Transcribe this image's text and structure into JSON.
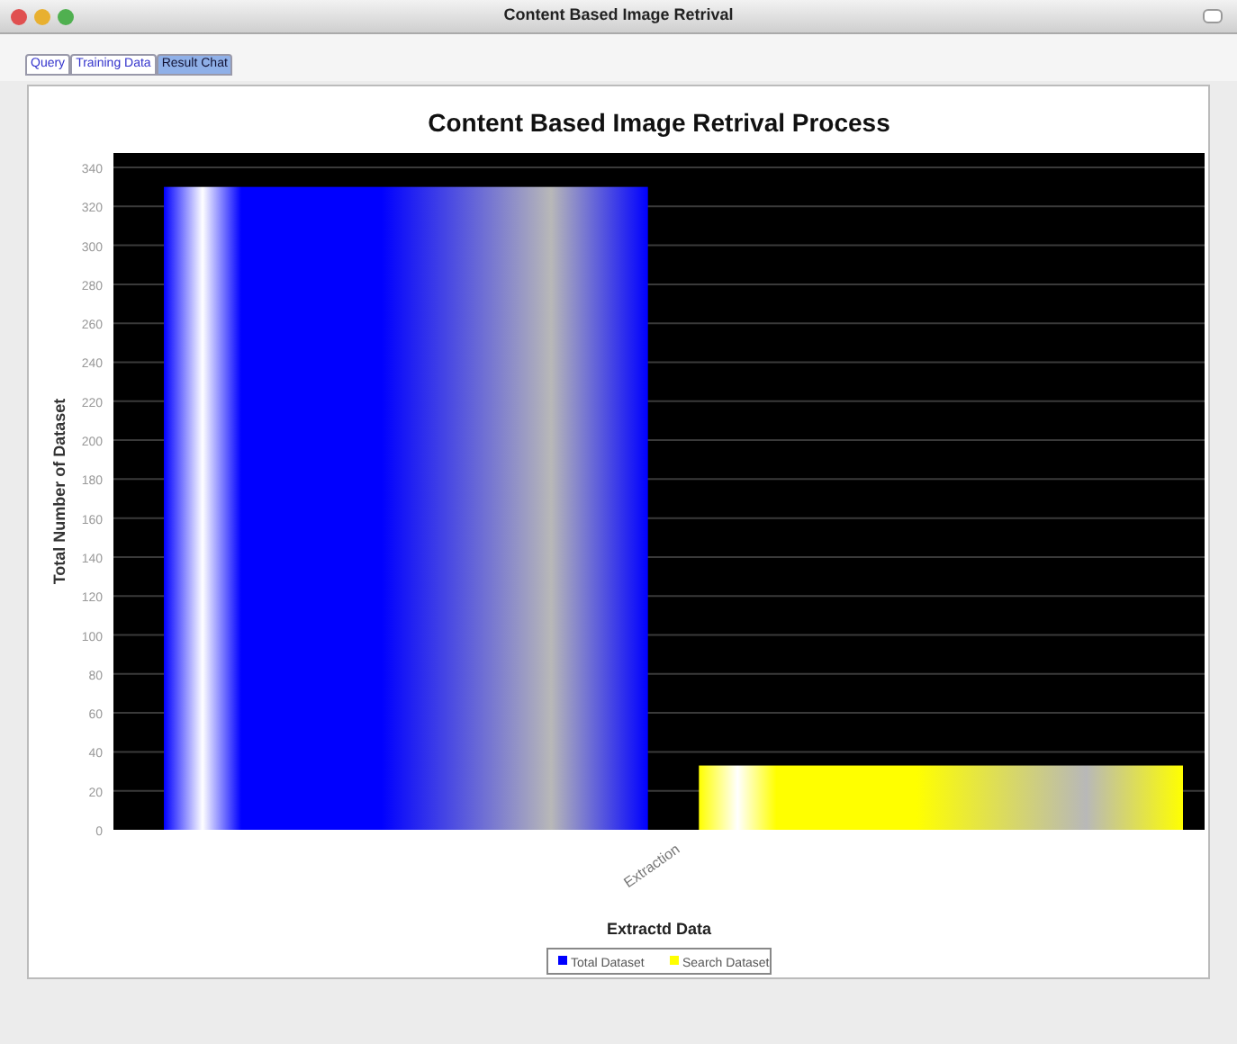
{
  "window": {
    "title": "Content Based Image Retrival"
  },
  "tabs": [
    {
      "label": "Query",
      "selected": false
    },
    {
      "label": "Training Data",
      "selected": false
    },
    {
      "label": "Result Chat",
      "selected": true
    }
  ],
  "chart_data": {
    "type": "bar",
    "title": "Content Based Image Retrival Process",
    "xlabel": "Extractd Data",
    "ylabel": "Total Number of Dataset",
    "categories": [
      "Extraction"
    ],
    "series": [
      {
        "name": "Total Dataset",
        "color": "#0000ff",
        "values": [
          330
        ]
      },
      {
        "name": "Search Dataset",
        "color": "#ffff00",
        "values": [
          33
        ]
      }
    ],
    "grid": true,
    "legend": "bottom",
    "ylim": [
      0,
      340
    ],
    "yticks": [
      0,
      20,
      40,
      60,
      80,
      100,
      120,
      140,
      160,
      180,
      200,
      220,
      240,
      260,
      280,
      300,
      320,
      340
    ]
  }
}
